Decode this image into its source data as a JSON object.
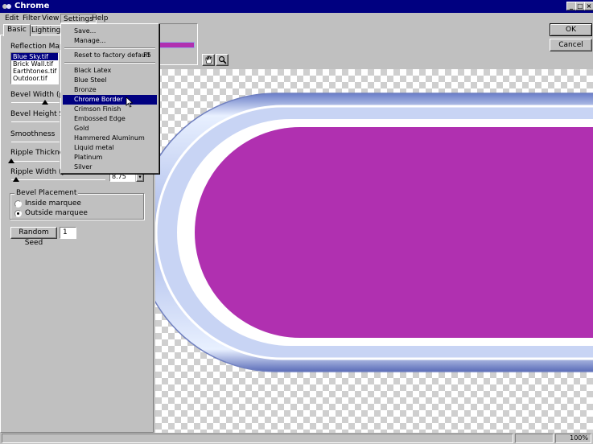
{
  "window": {
    "title": "Chrome"
  },
  "titlebar_buttons": {
    "minimize": "_",
    "maximize": "□",
    "close": "×"
  },
  "menubar": {
    "edit": "Edit",
    "filter": "Filter",
    "view": "View",
    "settings": "Settings",
    "help": "Help"
  },
  "tabs": {
    "basic": "Basic",
    "lighting": "Lighting"
  },
  "controls": {
    "reflection_map_label": "Reflection Map",
    "reflection_maps": [
      "Blue Sky.tif",
      "Brick Wall.tif",
      "Earthtones.tif",
      "Outdoor.tif"
    ],
    "bevel_width_label": "Bevel Width (pixe",
    "bevel_height_label": "Bevel Height Scal",
    "smoothness_label": "Smoothness",
    "ripple_thickness_label": "Ripple Thickness",
    "ripple_width_label": "Ripple Width (pixels)",
    "ripple_width_value": "8.75",
    "bevel_placement_label": "Bevel Placement",
    "inside_marquee": "Inside marquee",
    "outside_marquee": "Outside marquee",
    "bevel_placement_selected": "Outside marquee",
    "random_seed_label": "Random Seed",
    "random_seed_value": "1"
  },
  "buttons": {
    "ok": "OK",
    "cancel": "Cancel"
  },
  "settings_menu": {
    "save": "Save...",
    "manage": "Manage...",
    "reset": "Reset to factory default",
    "reset_shortcut": "F5",
    "presets": [
      "Black Latex",
      "Blue Steel",
      "Bronze",
      "Chrome Border",
      "Crimson Finish",
      "Embossed Edge",
      "Gold",
      "Hammered Aluminum",
      "Liquid metal",
      "Platinum",
      "Silver"
    ],
    "highlighted": "Chrome Border"
  },
  "status": {
    "zoom": "100%"
  },
  "colors": {
    "title_bar": "#000080",
    "fill": "#b030b0",
    "bevel": "#9aaee0",
    "face": "#c0c0c0"
  },
  "icons": {
    "hand": "hand-icon",
    "zoom": "zoom-icon",
    "pointer": "mouse-pointer-icon"
  }
}
